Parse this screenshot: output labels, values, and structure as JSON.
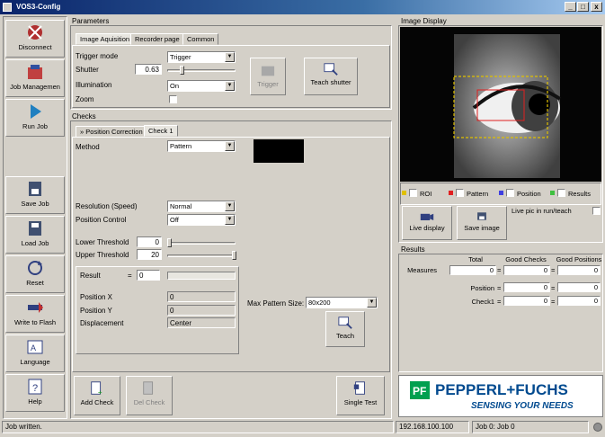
{
  "window": {
    "title": "VOS3-Config",
    "minimize": "_",
    "maximize": "□",
    "close": "x"
  },
  "nav": {
    "disconnect": "Disconnect",
    "job_management": "Job Managemen",
    "run_job": "Run Job",
    "save_job": "Save Job",
    "load_job": "Load Job",
    "reset": "Reset",
    "write_flash": "Write to Flash",
    "language": "Language",
    "help": "Help"
  },
  "parameters": {
    "title": "Parameters",
    "tabs": [
      "Image Aquisition",
      "Recorder page",
      "Common"
    ],
    "trigger_mode_label": "Trigger mode",
    "trigger_mode_value": "Trigger",
    "shutter_label": "Shutter",
    "shutter_value": "0.63",
    "illumination_label": "Illumination",
    "illumination_value": "On",
    "zoom_label": "Zoom",
    "trigger_button": "Trigger",
    "teach_shutter_button": "Teach shutter"
  },
  "checks": {
    "title": "Checks",
    "tabs": [
      "Position Correction",
      "Check 1"
    ],
    "method_label": "Method",
    "method_value": "Pattern",
    "resolution_label": "Resolution (Speed)",
    "resolution_value": "Normal",
    "position_control_label": "Position Control",
    "position_control_value": "Off",
    "lower_threshold_label": "Lower Threshold",
    "lower_threshold_value": "0",
    "upper_threshold_label": "Upper Threshold",
    "upper_threshold_value": "20",
    "result_label": "Result",
    "result_eq": "=",
    "result_value": "0",
    "position_x_label": "Position X",
    "position_x_value": "0",
    "position_y_label": "Position Y",
    "position_y_value": "0",
    "displacement_label": "Displacement",
    "displacement_value": "Center",
    "max_pattern_label": "Max Pattern Size:",
    "max_pattern_value": "80x200",
    "teach_button": "Teach",
    "add_check": "Add Check",
    "del_check": "Del Check",
    "single_test": "Single Test"
  },
  "image_display": {
    "title": "Image Display",
    "legend": [
      "ROI",
      "Pattern",
      "Position",
      "Results"
    ],
    "legend_colors": [
      "#e0c000",
      "#e02020",
      "#4040e0",
      "#40c040"
    ],
    "live_display": "Live display",
    "save_image": "Save image",
    "live_pic_label": "Live pic in run/teach"
  },
  "results": {
    "title": "Results",
    "columns": [
      "Total",
      "Good Checks",
      "Good Positions"
    ],
    "rows": [
      {
        "label": "Measures",
        "total": "0",
        "good_checks": "0",
        "good_positions": "0"
      },
      {
        "label": "Position",
        "total": "0",
        "good_checks": "0",
        "good_positions": "0"
      },
      {
        "label": "Check1",
        "total": "0",
        "good_checks": "0",
        "good_positions": "0"
      }
    ]
  },
  "logo": {
    "brand": "PEPPERL+FUCHS",
    "slogan": "SENSING YOUR NEEDS"
  },
  "status": {
    "message": "Job written.",
    "ip": "192.168.100.100",
    "job": "Job 0: Job 0"
  }
}
